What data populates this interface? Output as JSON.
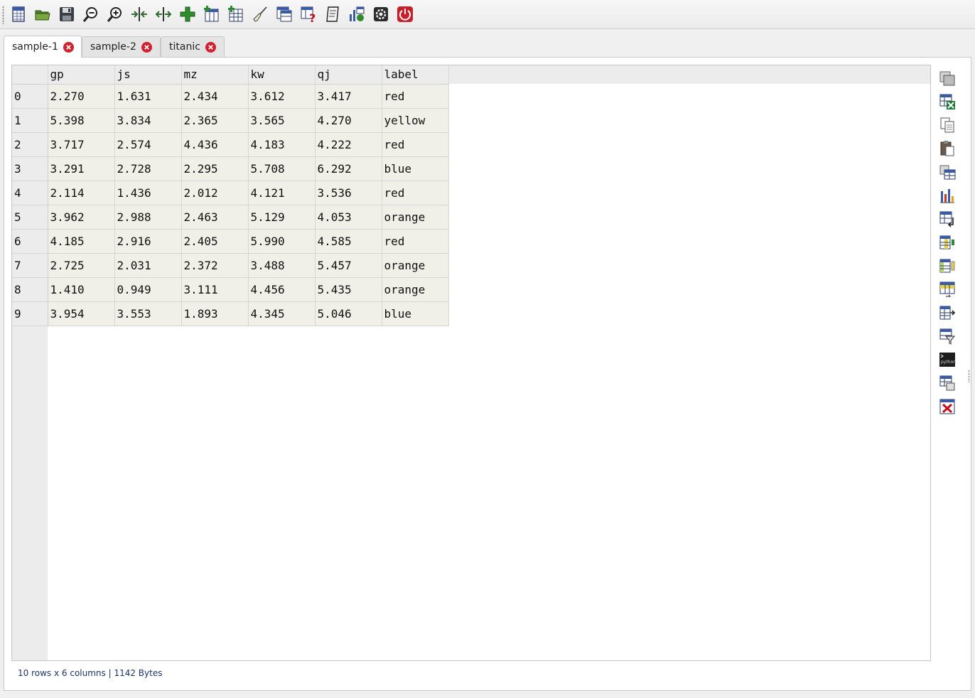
{
  "toolbar": {
    "icons": [
      "new-table-icon",
      "open-folder-icon",
      "save-icon",
      "zoom-out-icon",
      "zoom-in-icon",
      "contract-columns-icon",
      "expand-columns-icon",
      "add-icon",
      "add-column-icon",
      "add-table-icon",
      "clean-icon",
      "table-info-icon",
      "help-icon",
      "notepad-icon",
      "plot-icon",
      "settings-icon",
      "power-icon"
    ]
  },
  "tabs": [
    {
      "label": "sample-1",
      "active": true
    },
    {
      "label": "sample-2",
      "active": false
    },
    {
      "label": "titanic",
      "active": false
    }
  ],
  "table": {
    "columns": [
      "gp",
      "js",
      "mz",
      "kw",
      "qj",
      "label"
    ],
    "rows": [
      {
        "index": "0",
        "cells": [
          "2.270",
          "1.631",
          "2.434",
          "3.612",
          "3.417",
          "red"
        ]
      },
      {
        "index": "1",
        "cells": [
          "5.398",
          "3.834",
          "2.365",
          "3.565",
          "4.270",
          "yellow"
        ]
      },
      {
        "index": "2",
        "cells": [
          "3.717",
          "2.574",
          "4.436",
          "4.183",
          "4.222",
          "red"
        ]
      },
      {
        "index": "3",
        "cells": [
          "3.291",
          "2.728",
          "2.295",
          "5.708",
          "6.292",
          "blue"
        ]
      },
      {
        "index": "4",
        "cells": [
          "2.114",
          "1.436",
          "2.012",
          "4.121",
          "3.536",
          "red"
        ]
      },
      {
        "index": "5",
        "cells": [
          "3.962",
          "2.988",
          "2.463",
          "5.129",
          "4.053",
          "orange"
        ]
      },
      {
        "index": "6",
        "cells": [
          "4.185",
          "2.916",
          "2.405",
          "5.990",
          "4.585",
          "red"
        ]
      },
      {
        "index": "7",
        "cells": [
          "2.725",
          "2.031",
          "2.372",
          "3.488",
          "5.457",
          "orange"
        ]
      },
      {
        "index": "8",
        "cells": [
          "1.410",
          "0.949",
          "3.111",
          "4.456",
          "5.435",
          "orange"
        ]
      },
      {
        "index": "9",
        "cells": [
          "3.954",
          "3.553",
          "1.893",
          "4.345",
          "5.046",
          "blue"
        ]
      }
    ]
  },
  "sidebar": {
    "icons": [
      "copy-table-icon",
      "export-excel-icon",
      "copy-icon",
      "paste-icon",
      "merge-tables-icon",
      "bar-chart-icon",
      "transpose-icon",
      "insert-column-icon",
      "move-column-icon",
      "convert-icon",
      "export-column-icon",
      "filter-icon",
      "python-icon",
      "duplicate-table-icon",
      "delete-table-icon"
    ]
  },
  "status": {
    "text": "10 rows x 6 columns | 1142 Bytes"
  },
  "colors": {
    "close_badge": "#d2202e",
    "cell_bg": "#f0f0e8",
    "header_bg": "#ececec",
    "status_text": "#1c3466"
  }
}
